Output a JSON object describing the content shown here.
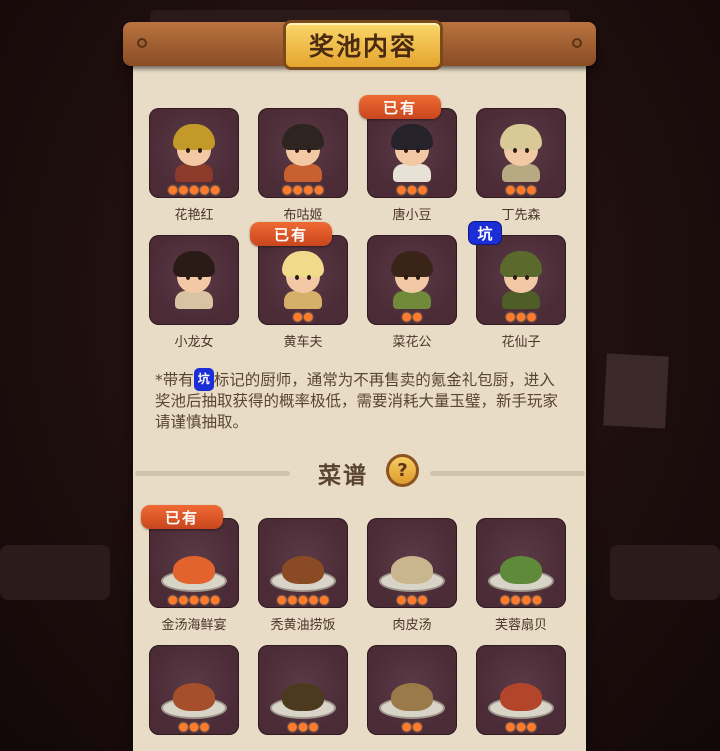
{
  "title": "奖池内容",
  "owned_label": "已有",
  "pit_label": "坑",
  "chefs": [
    {
      "name": "花艳红",
      "flames": 5,
      "owned": false,
      "pit": false,
      "hair": "#c39a2a",
      "body": "#8c3b2a"
    },
    {
      "name": "布咕姬",
      "flames": 4,
      "owned": false,
      "pit": false,
      "hair": "#2e2520",
      "body": "#c8612f"
    },
    {
      "name": "唐小豆",
      "flames": 3,
      "owned": true,
      "pit": false,
      "hair": "#26222a",
      "body": "#e8e2d6"
    },
    {
      "name": "丁先森",
      "flames": 3,
      "owned": false,
      "pit": false,
      "hair": "#d9c996",
      "body": "#b7a982"
    },
    {
      "name": "小龙女",
      "flames": 0,
      "owned": false,
      "pit": false,
      "hair": "#2a1b16",
      "body": "#d8c3a2"
    },
    {
      "name": "黄车夫",
      "flames": 2,
      "owned": true,
      "pit": false,
      "hair": "#f1da8a",
      "body": "#d6b06a"
    },
    {
      "name": "菜花公",
      "flames": 2,
      "owned": false,
      "pit": false,
      "hair": "#3a2418",
      "body": "#6f8a3a"
    },
    {
      "name": "花仙子",
      "flames": 3,
      "owned": false,
      "pit": true,
      "hair": "#5b6a2c",
      "body": "#4e5e26"
    }
  ],
  "note": {
    "prefix": "*带有",
    "pit": "坑",
    "suffix": "标记的厨师，通常为不再售卖的氪金礼包厨，进入奖池后抽取获得的概率极低，需要消耗大量玉璧，新手玩家请谨慎抽取。"
  },
  "recipes_title": "菜谱",
  "help_icon": "?",
  "recipes": [
    {
      "name": "金汤海鲜宴",
      "flames": 5,
      "owned": true,
      "food": "#e2632d"
    },
    {
      "name": "秃黄油捞饭",
      "flames": 5,
      "owned": false,
      "food": "#8a4a24"
    },
    {
      "name": "肉皮汤",
      "flames": 3,
      "owned": false,
      "food": "#c9b58e"
    },
    {
      "name": "芙蓉扇贝",
      "flames": 4,
      "owned": false,
      "food": "#5f8a3a"
    },
    {
      "name": "",
      "flames": 3,
      "owned": false,
      "food": "#a5502a"
    },
    {
      "name": "",
      "flames": 3,
      "owned": false,
      "food": "#4c3a1e"
    },
    {
      "name": "",
      "flames": 2,
      "owned": false,
      "food": "#9a7a48"
    },
    {
      "name": "",
      "flames": 3,
      "owned": false,
      "food": "#b2452a"
    }
  ],
  "colors": {
    "accent": "#e5a52f",
    "owned": "#d9522a",
    "pit": "#1c2fd6"
  }
}
